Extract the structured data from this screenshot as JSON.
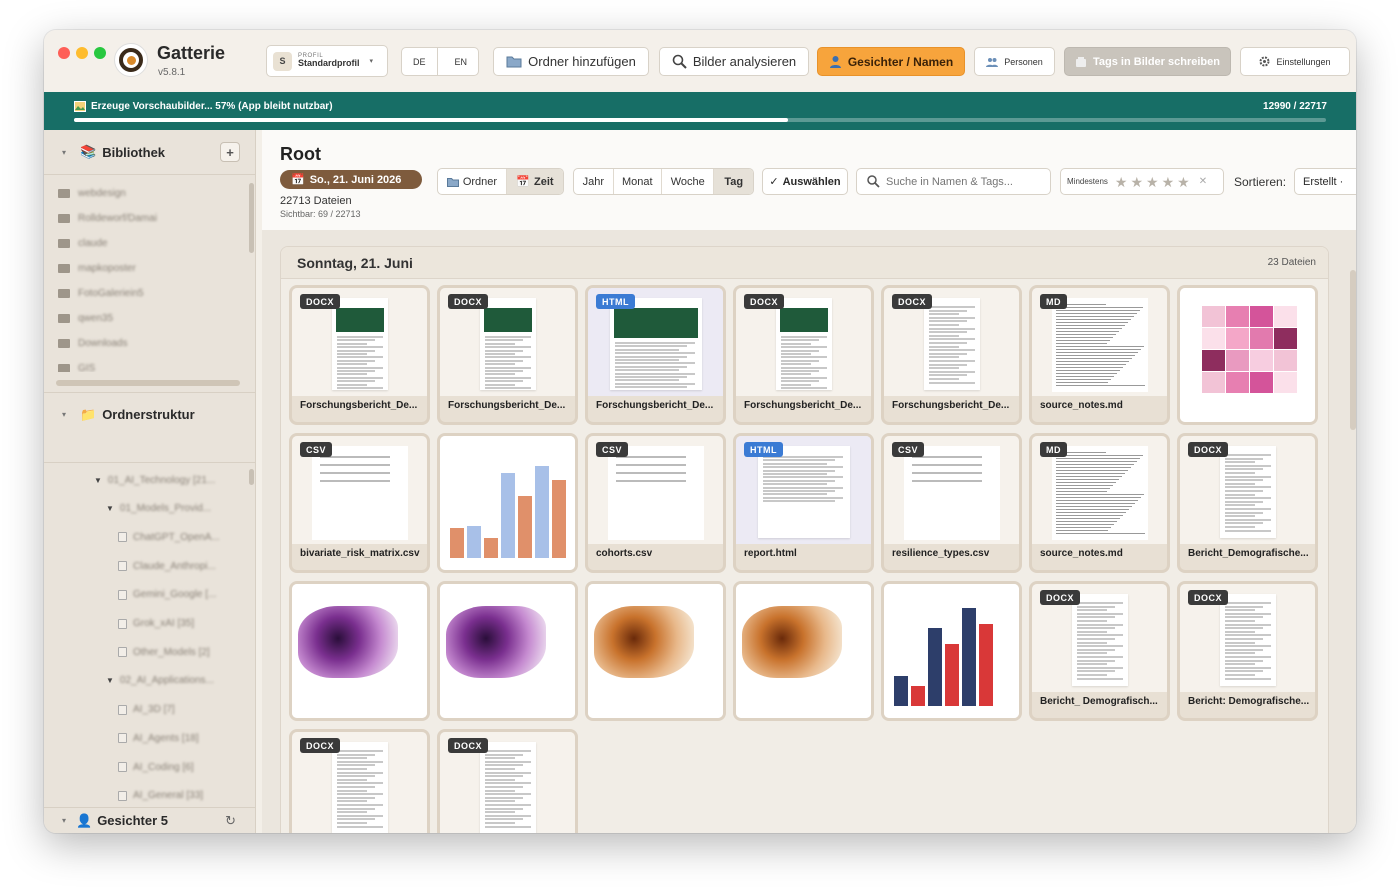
{
  "app": {
    "name": "Gatterie",
    "version": "v5.8.1"
  },
  "toolbar": {
    "profile_caption": "PROFIL",
    "profile_name": "Standardprofil",
    "profile_initial": "S",
    "lang_de": "DE",
    "lang_en": "EN",
    "add_folder": "Ordner hinzufügen",
    "analyze": "Bilder analysieren",
    "faces_names": "Gesichter / Namen",
    "persons": "Personen",
    "write_tags": "Tags in Bilder schreiben",
    "settings": "Einstellungen"
  },
  "progress": {
    "label": "Erzeuge Vorschaubilder... 57% (App bleibt nutzbar)",
    "count": "12990 / 22717",
    "percent": 57
  },
  "sidebar": {
    "library_title": "Bibliothek",
    "library_items": [
      "webdesign",
      "Rolldeworf/Damai",
      "claude",
      "mapkoposter",
      "FotoGaleriein5",
      "qwen35",
      "Downloads",
      "GIS"
    ],
    "folder_structure_title": "Ordnerstruktur",
    "tree": [
      {
        "label": "01_AI_Technology [21...",
        "level": 1,
        "expanded": true
      },
      {
        "label": "01_Models_Provid...",
        "level": 2,
        "expanded": true
      },
      {
        "label": "ChatGPT_OpenA...",
        "level": 3
      },
      {
        "label": "Claude_Anthropi...",
        "level": 3
      },
      {
        "label": "Gemini_Google [...",
        "level": 3
      },
      {
        "label": "Grok_xAI [35]",
        "level": 3
      },
      {
        "label": "Other_Models [2]",
        "level": 3
      },
      {
        "label": "02_AI_Applications...",
        "level": 2,
        "expanded": true
      },
      {
        "label": "AI_3D [7]",
        "level": 3
      },
      {
        "label": "AI_Agents [18]",
        "level": 3
      },
      {
        "label": "AI_Coding [6]",
        "level": 3
      },
      {
        "label": "AI_General [33]",
        "level": 3
      }
    ],
    "faces_title": "Gesichter 5"
  },
  "main": {
    "title": "Root",
    "date_pill": "So., 21. Juni 2026",
    "file_count": "22713 Dateien",
    "visible": "Sichtbar: 69 / 22713",
    "view_folder": "Ordner",
    "view_time": "Zeit",
    "period": [
      "Jahr",
      "Monat",
      "Woche",
      "Tag"
    ],
    "select": "Auswählen",
    "search_placeholder": "Suche in Namen & Tags...",
    "min_rating_label": "Mindestens",
    "sort_label": "Sortieren:",
    "sort_value": "Erstellt ·"
  },
  "group": {
    "day": "Sonntag, 21. Juni",
    "count": "23 Dateien",
    "items": [
      {
        "type": "DOCX",
        "name": "Forschungsbericht_De..."
      },
      {
        "type": "DOCX",
        "name": "Forschungsbericht_De..."
      },
      {
        "type": "HTML",
        "name": "Forschungsbericht_De..."
      },
      {
        "type": "DOCX",
        "name": "Forschungsbericht_De..."
      },
      {
        "type": "DOCX",
        "name": "Forschungsbericht_De..."
      },
      {
        "type": "MD",
        "name": "source_notes.md"
      },
      {
        "type": "",
        "name": ""
      },
      {
        "type": "CSV",
        "name": "bivariate_risk_matrix.csv"
      },
      {
        "type": "",
        "name": ""
      },
      {
        "type": "CSV",
        "name": "cohorts.csv"
      },
      {
        "type": "HTML",
        "name": "report.html"
      },
      {
        "type": "CSV",
        "name": "resilience_types.csv"
      },
      {
        "type": "MD",
        "name": "source_notes.md"
      },
      {
        "type": "DOCX",
        "name": "Bericht_Demografische..."
      },
      {
        "type": "",
        "name": ""
      },
      {
        "type": "",
        "name": ""
      },
      {
        "type": "",
        "name": ""
      },
      {
        "type": "",
        "name": ""
      },
      {
        "type": "",
        "name": ""
      },
      {
        "type": "DOCX",
        "name": "Bericht_ Demografisch..."
      },
      {
        "type": "DOCX",
        "name": "Bericht: Demografische..."
      },
      {
        "type": "DOCX",
        "name": ""
      },
      {
        "type": "DOCX",
        "name": ""
      }
    ]
  },
  "colors": {
    "accent": "#f7a43c",
    "progress_bg": "#176e66",
    "date_pill": "#7e5b3d",
    "html_badge": "#3b7bd4"
  }
}
